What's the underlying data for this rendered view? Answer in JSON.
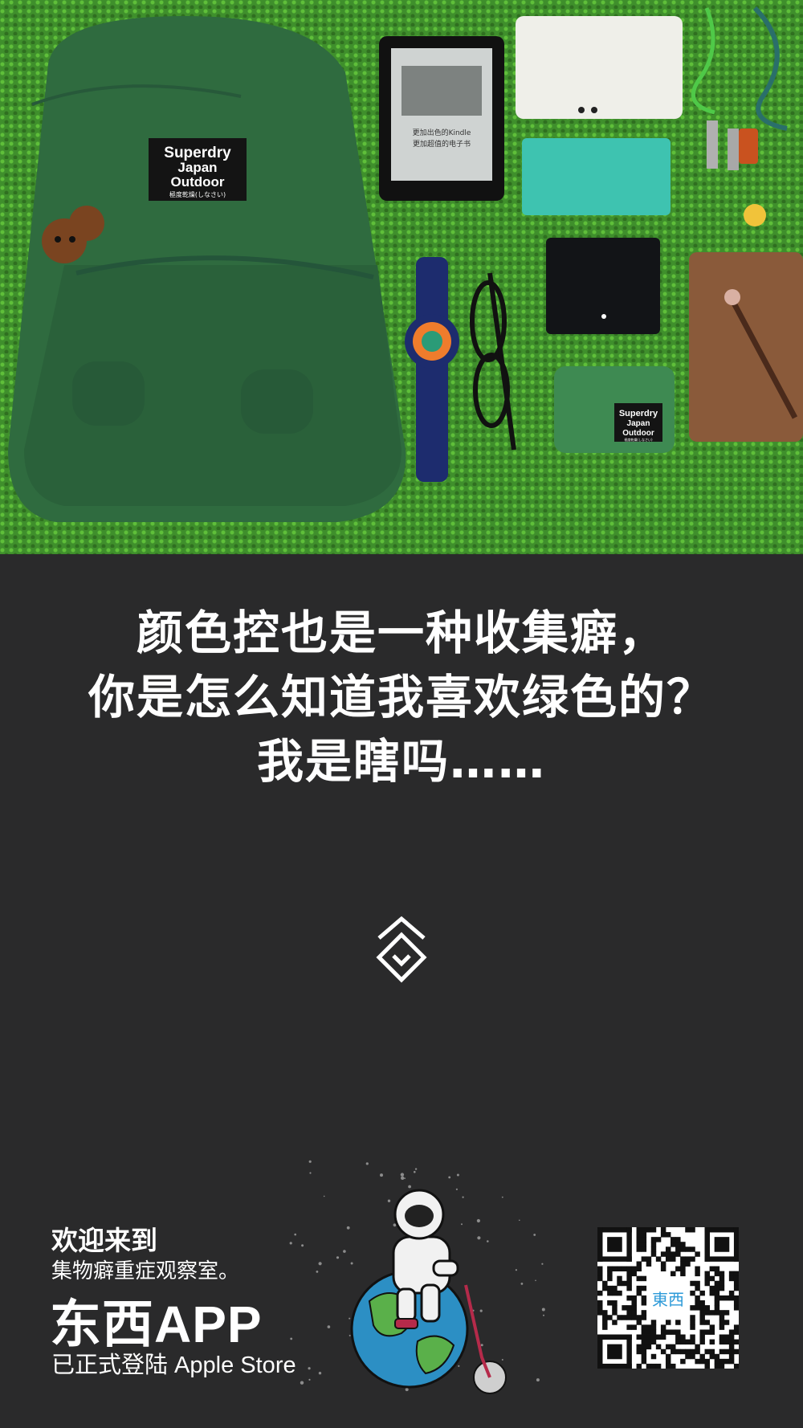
{
  "hero": {
    "patch_lines": [
      "Superdry",
      "Japan",
      "Outdoor",
      "極度乾燥(しなさい)"
    ],
    "wallet_patch_lines": [
      "Superdry",
      "Japan",
      "Outdoor",
      "極度乾燥(しなさい)"
    ],
    "kindle_screen_lines": [
      "更加出色的Kindle",
      "更加超值的电子书"
    ]
  },
  "caption": {
    "line1": "颜色控也是一种收集癖，",
    "line2": "你是怎么知道我喜欢绿色的？",
    "line3": "我是瞎吗……"
  },
  "scroll_hint": {
    "icon": "double-chevron-down-icon"
  },
  "footer": {
    "welcome_title": "欢迎来到",
    "welcome_sub": "集物癖重症观察室。",
    "app_name": "东西APP",
    "availability": "已正式登陆 Apple Store",
    "qr_logo_text": "東西"
  },
  "colors": {
    "background": "#2a2a2b",
    "carpet": "#3f8f2c",
    "backpack": "#2f6b3f",
    "text": "#ffffff",
    "qr_logo": "#2d9ad8"
  }
}
